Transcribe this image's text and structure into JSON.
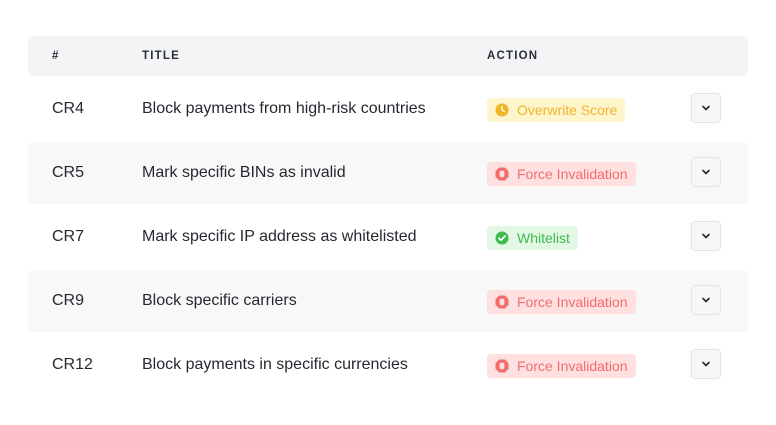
{
  "table": {
    "headers": {
      "id": "#",
      "title": "TITLE",
      "action": "ACTION"
    },
    "rows": [
      {
        "id": "CR4",
        "title": "Block payments from high-risk countries",
        "action": "Overwrite Score",
        "action_type": "warning",
        "icon": "clock-circle-icon"
      },
      {
        "id": "CR5",
        "title": "Mark specific BINs as invalid",
        "action": "Force Invalidation",
        "action_type": "danger",
        "icon": "stop-hand-icon"
      },
      {
        "id": "CR7",
        "title": "Mark specific IP address as whitelisted",
        "action": "Whitelist",
        "action_type": "success",
        "icon": "check-circle-icon"
      },
      {
        "id": "CR9",
        "title": "Block specific carriers",
        "action": "Force Invalidation",
        "action_type": "danger",
        "icon": "stop-hand-icon"
      },
      {
        "id": "CR12",
        "title": "Block payments in specific currencies",
        "action": "Force Invalidation",
        "action_type": "danger",
        "icon": "stop-hand-icon"
      }
    ]
  },
  "colors": {
    "warning": "#f0b429",
    "danger": "#f26d6d",
    "success": "#3fb950",
    "header_bg": "#f3f4f6",
    "stripe_bg": "#f8f8f9"
  }
}
